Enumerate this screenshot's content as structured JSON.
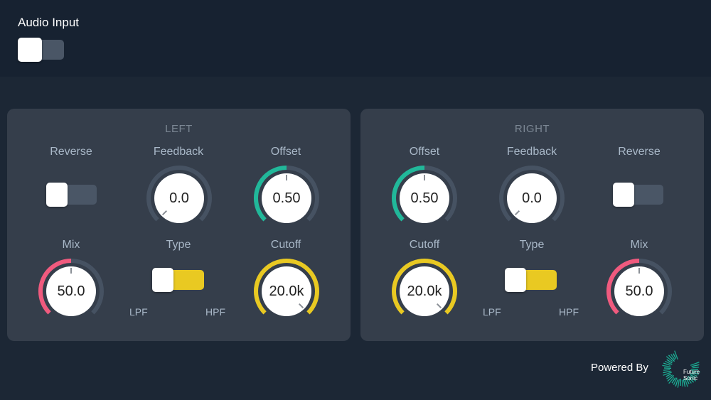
{
  "audio_input": {
    "label": "Audio Input",
    "on": false
  },
  "left": {
    "title": "LEFT",
    "reverse": {
      "label": "Reverse",
      "on": false
    },
    "feedback": {
      "label": "Feedback",
      "value": "0.0",
      "level": 0.0
    },
    "offset": {
      "label": "Offset",
      "value": "0.50",
      "level": 0.5
    },
    "mix": {
      "label": "Mix",
      "value": "50.0",
      "level": 0.5
    },
    "type": {
      "label": "Type",
      "low": "LPF",
      "high": "HPF",
      "selected": "LPF"
    },
    "cutoff": {
      "label": "Cutoff",
      "value": "20.0k",
      "level": 1.0
    }
  },
  "right": {
    "title": "RIGHT",
    "offset": {
      "label": "Offset",
      "value": "0.50",
      "level": 0.5
    },
    "feedback": {
      "label": "Feedback",
      "value": "0.0",
      "level": 0.0
    },
    "reverse": {
      "label": "Reverse",
      "on": false
    },
    "cutoff": {
      "label": "Cutoff",
      "value": "20.0k",
      "level": 1.0
    },
    "type": {
      "label": "Type",
      "low": "LPF",
      "high": "HPF",
      "selected": "LPF"
    },
    "mix": {
      "label": "Mix",
      "value": "50.0",
      "level": 0.5
    }
  },
  "footer": {
    "powered_by": "Powered By",
    "logo_line1": "Future",
    "logo_line2": "Sonic"
  },
  "colors": {
    "offset_arc": "#21b89a",
    "mix_arc": "#f05a7e",
    "cutoff_arc": "#e9c922",
    "track": "#465262",
    "toggle_on_yellow": "#e9c922"
  }
}
